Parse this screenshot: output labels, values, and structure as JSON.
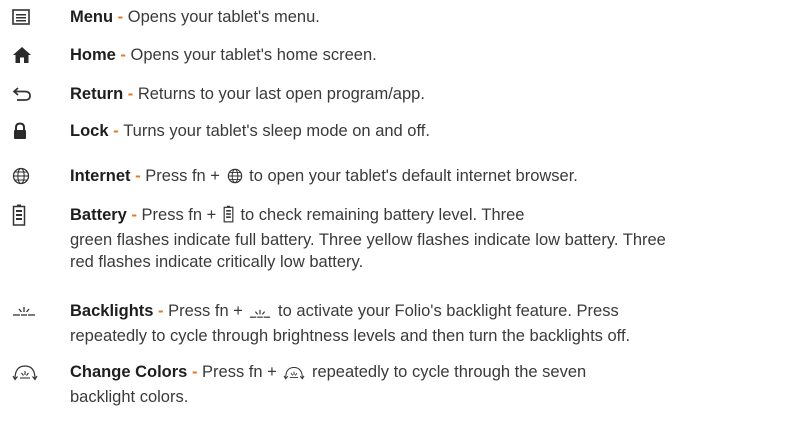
{
  "items": [
    {
      "icon": "menu-icon",
      "term": "Menu",
      "sep": " - ",
      "desc": "Opens your tablet's menu."
    },
    {
      "icon": "home-icon",
      "term": "Home",
      "sep": " - ",
      "desc": "Opens your tablet's home screen."
    },
    {
      "icon": "return-icon",
      "term": "Return",
      "sep": " - ",
      "desc": "Returns to your last open program/app."
    },
    {
      "icon": "lock-icon",
      "term": "Lock",
      "sep": " - ",
      "desc": "Turns your tablet's sleep mode on and off."
    },
    {
      "icon": "internet-icon",
      "term": "Internet",
      "sep": " - ",
      "pre": "Press ",
      "key": "fn",
      "plus": " + ",
      "post": " to open your tablet's default internet browser."
    },
    {
      "icon": "battery-icon",
      "term": "Battery",
      "sep": " - ",
      "pre": "Press ",
      "key": "fn",
      "plus": " + ",
      "post": " to check remaining battery level. Three",
      "line2": "green flashes indicate full battery. Three yellow flashes indicate low battery. Three",
      "line3": "red flashes indicate critically low battery."
    },
    {
      "icon": "backlight-icon",
      "term": "Backlights",
      "sep": " - ",
      "pre": "Press ",
      "key": "fn",
      "plus": " + ",
      "post": " to activate your Folio's backlight feature. Press",
      "line2": "repeatedly to cycle through brightness levels and then turn the backlights off."
    },
    {
      "icon": "change-colors-icon",
      "term": "Change Colors",
      "sep": " - ",
      "pre": "Press ",
      "key": "fn",
      "plus": " + ",
      "post": " repeatedly to cycle through the seven",
      "line2": "backlight colors."
    }
  ],
  "colors": {
    "accent": "#e87722",
    "text": "#3a3a3a",
    "term": "#1e1e1e"
  }
}
